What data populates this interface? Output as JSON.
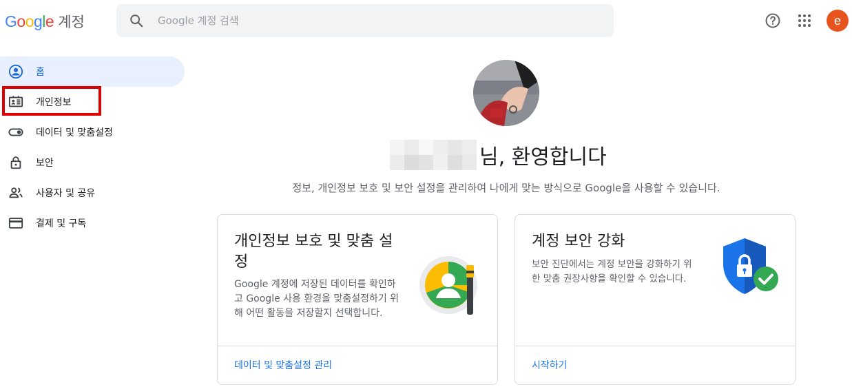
{
  "header": {
    "logo_letters": [
      "G",
      "o",
      "o",
      "g",
      "l",
      "e"
    ],
    "product": "계정",
    "search_placeholder": "Google 계정 검색",
    "avatar_letter": "e"
  },
  "sidebar": {
    "items": [
      {
        "label": "홈",
        "icon": "account-circle-icon"
      },
      {
        "label": "개인정보",
        "icon": "id-card-icon"
      },
      {
        "label": "데이터 및 맞춤설정",
        "icon": "toggle-icon"
      },
      {
        "label": "보안",
        "icon": "lock-icon"
      },
      {
        "label": "사용자 및 공유",
        "icon": "people-icon"
      },
      {
        "label": "결제 및 구독",
        "icon": "credit-card-icon"
      }
    ]
  },
  "main": {
    "welcome": "님, 환영합니다",
    "subtitle": "정보, 개인정보 보호 및 보안 설정을 관리하여 나에게 맞는 방식으로 Google을 사용할 수 있습니다.",
    "cards": [
      {
        "title": "개인정보 보호 및 맞춤 설정",
        "description": "Google 계정에 저장된 데이터를 확인하고 Google 사용 환경을 맞춤설정하기 위해 어떤 활동을 저장할지 선택합니다.",
        "link": "데이터 및 맞춤설정 관리"
      },
      {
        "title": "계정 보안 강화",
        "description": "보안 진단에서는 계정 보안을 강화하기 위한 맞춤 권장사항을 확인할 수 있습니다.",
        "link": "시작하기"
      }
    ]
  },
  "colors": {
    "accent": "#1a73e8",
    "active_bg": "#e8f0fe",
    "highlight_border": "#e00000",
    "avatar_bg": "#e8541e"
  }
}
